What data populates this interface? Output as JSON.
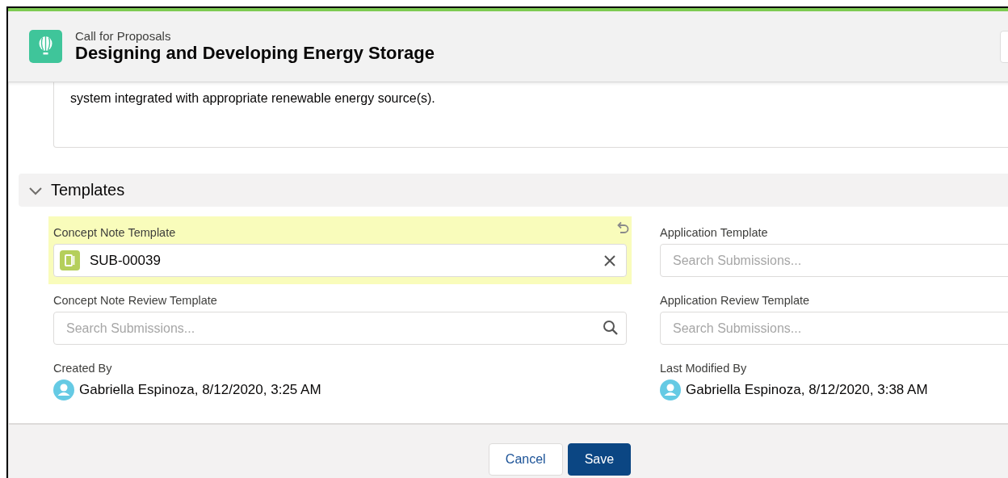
{
  "header": {
    "object_type": "Call for Proposals",
    "title": "Designing and Developing Energy Storage"
  },
  "description": {
    "text": "system integrated with appropriate renewable energy source(s)."
  },
  "section": {
    "title": "Templates",
    "expanded": true
  },
  "fields": [
    {
      "kind": "lookup_filled",
      "label": "Concept Note Template",
      "value": "SUB-00039",
      "changed": true
    },
    {
      "kind": "lookup_empty",
      "label": "Application Template",
      "placeholder": "Search Submissions...",
      "changed": false
    },
    {
      "kind": "lookup_search",
      "label": "Concept Note Review Template",
      "placeholder": "Search Submissions...",
      "changed": false
    },
    {
      "kind": "lookup_empty",
      "label": "Application Review Template",
      "placeholder": "Search Submissions...",
      "changed": false
    },
    {
      "kind": "user",
      "label": "Created By",
      "user": "Gabriella Espinoza",
      "timestamp": ", 8/12/2020, 3:25 AM"
    },
    {
      "kind": "user",
      "label": "Last Modified By",
      "user": "Gabriella Espinoza",
      "timestamp": ", 8/12/2020, 3:38 AM"
    }
  ],
  "buttons": [
    {
      "label": "Cancel",
      "kind": "neutral"
    },
    {
      "label": "Save",
      "kind": "brand"
    }
  ]
}
